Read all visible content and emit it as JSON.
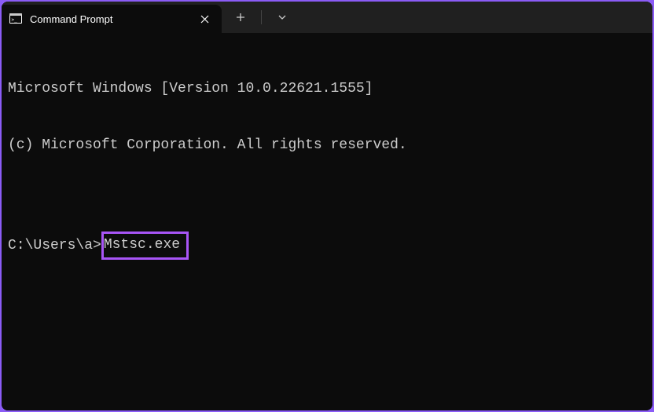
{
  "titlebar": {
    "tab_title": "Command Prompt"
  },
  "terminal": {
    "line1": "Microsoft Windows [Version 10.0.22621.1555]",
    "line2": "(c) Microsoft Corporation. All rights reserved.",
    "blank": "",
    "prompt": "C:\\Users\\a>",
    "command": "Mstsc.exe"
  },
  "highlight_color": "#a855f7"
}
